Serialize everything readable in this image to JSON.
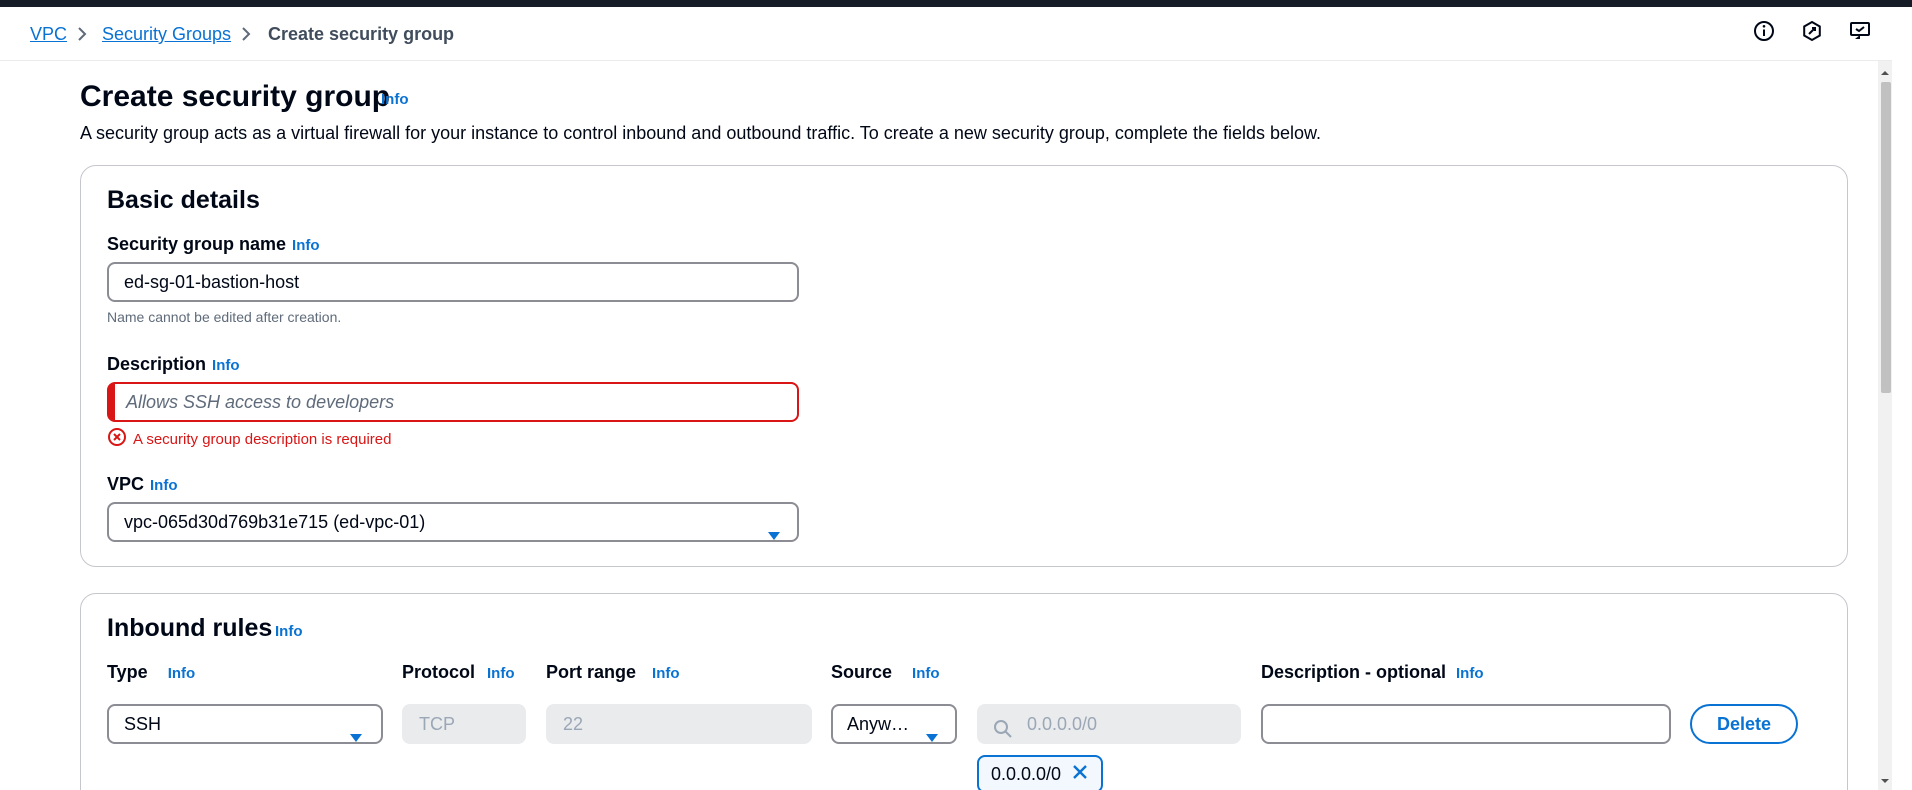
{
  "breadcrumb": {
    "items": [
      "VPC",
      "Security Groups"
    ],
    "current": "Create security group"
  },
  "header": {
    "title": "Create security group",
    "info": "Info",
    "description": "A security group acts as a virtual firewall for your instance to control inbound and outbound traffic. To create a new security group, complete the fields below."
  },
  "basic_details": {
    "title": "Basic details",
    "name": {
      "label": "Security group name",
      "info": "Info",
      "value": "ed-sg-01-bastion-host",
      "hint": "Name cannot be edited after creation."
    },
    "description": {
      "label": "Description",
      "info": "Info",
      "placeholder": "Allows SSH access to developers",
      "error": "A security group description is required"
    },
    "vpc": {
      "label": "VPC",
      "info": "Info",
      "value": "vpc-065d30d769b31e715 (ed-vpc-01)"
    }
  },
  "inbound_rules": {
    "title": "Inbound rules",
    "info": "Info",
    "columns": {
      "type": "Type",
      "protocol": "Protocol",
      "port_range": "Port range",
      "source": "Source",
      "description": "Description - optional"
    },
    "rule": {
      "type": "SSH",
      "protocol": "TCP",
      "port_range": "22",
      "source_type": "Anyw…",
      "source_search_placeholder": "0.0.0.0/0",
      "source_token": "0.0.0.0/0",
      "description": "",
      "delete_label": "Delete"
    }
  },
  "colors": {
    "link": "#0972d3",
    "error": "#d91515",
    "text": "#000716",
    "topbar": "#161d26"
  }
}
